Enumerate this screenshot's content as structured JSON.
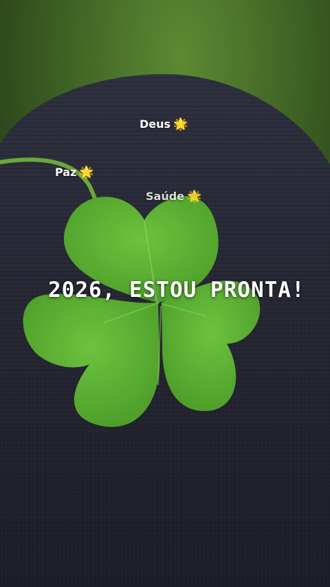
{
  "overlay": {
    "deus": "Deus",
    "paz": "Paz",
    "saude": "Saúde",
    "star": "🌟",
    "headline": "2026, ESTOU PRONTA!"
  },
  "colors": {
    "clover": "#5fb235",
    "fabric": "#24252f",
    "grass": "#3f6a22",
    "star": "#f7c31f"
  }
}
